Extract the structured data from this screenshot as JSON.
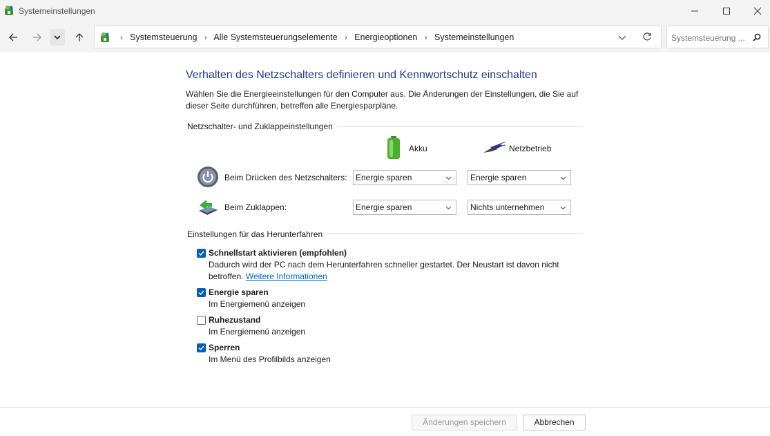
{
  "window": {
    "title": "Systemeinstellungen",
    "icons": [
      "control-panel-icon",
      "minimize-icon",
      "maximize-icon",
      "close-icon"
    ]
  },
  "navigation": {
    "breadcrumb": [
      "Systemsteuerung",
      "Alle Systemsteuerungselemente",
      "Energieoptionen",
      "Systemeinstellungen"
    ],
    "search_placeholder": "Systemsteuerung ..."
  },
  "main": {
    "heading": "Verhalten des Netzschalters definieren und Kennwortschutz einschalten",
    "description": "Wählen Sie die Energieeinstellungen für den Computer aus. Die Änderungen der Einstellungen, die Sie auf dieser Seite durchführen, betreffen alle Energiesparpläne.",
    "power_section": {
      "label": "Netzschalter- und Zuklappeinstellungen",
      "column_battery": "Akku",
      "column_plugged": "Netzbetrieb",
      "rows": [
        {
          "label": "Beim Drücken des Netzschalters:",
          "battery": "Energie sparen",
          "plugged": "Energie sparen"
        },
        {
          "label": "Beim Zuklappen:",
          "battery": "Energie sparen",
          "plugged": "Nichts unternehmen"
        }
      ]
    },
    "shutdown_section": {
      "label": "Einstellungen für das Herunterfahren",
      "options": [
        {
          "title": "Schnellstart aktivieren (empfohlen)",
          "checked": true,
          "description": "Dadurch wird der PC nach dem Herunterfahren schneller gestartet. Der Neustart ist davon nicht betroffen.",
          "link": "Weitere Informationen"
        },
        {
          "title": "Energie sparen",
          "checked": true,
          "description": "Im Energiemenü anzeigen"
        },
        {
          "title": "Ruhezustand",
          "checked": false,
          "description": "Im Energiemenü anzeigen"
        },
        {
          "title": "Sperren",
          "checked": true,
          "description": "Im Menü des Profilbilds anzeigen"
        }
      ]
    }
  },
  "footer": {
    "save_label": "Änderungen speichern",
    "cancel_label": "Abbrechen"
  },
  "colors": {
    "heading": "#1e3c8c",
    "checkbox": "#005fb8",
    "link": "#0066cc"
  }
}
